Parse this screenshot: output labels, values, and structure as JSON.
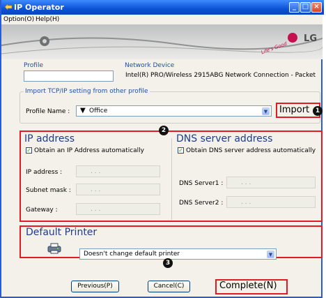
{
  "window": {
    "title": "IP Operator"
  },
  "menu": {
    "option": "Option(O)",
    "help": "Help(H)"
  },
  "brand": {
    "logo_text": "LG",
    "tagline": "Life's Good",
    "color": "#c4104f"
  },
  "profile": {
    "label": "Profile",
    "value": ""
  },
  "network_device": {
    "label": "Network Device",
    "value": "Intel(R) PRO/Wireless 2915ABG Network Connection - Packet"
  },
  "import_group": {
    "label": "Import TCP/IP setting from other profile",
    "profile_name_label": "Profile Name :",
    "profile_name_value": "Office",
    "import_button": "Import"
  },
  "ip_address": {
    "heading": "IP address",
    "auto_checkbox": "Obtain an IP Address automatically",
    "auto_checked": true,
    "fields": [
      {
        "label": "IP address :",
        "value": ". . ."
      },
      {
        "label": "Subnet mask :",
        "value": ". . ."
      },
      {
        "label": "Gateway :",
        "value": ". . ."
      }
    ]
  },
  "dns": {
    "heading": "DNS server address",
    "auto_checkbox": "Obtain DNS server address automatically",
    "auto_checked": true,
    "fields": [
      {
        "label": "DNS Server1 :",
        "value": ". . ."
      },
      {
        "label": "DNS Server2 :",
        "value": ". . ."
      }
    ]
  },
  "printer": {
    "heading": "Default Printer",
    "value": "Doesn't change default printer"
  },
  "badges": {
    "one": "1",
    "two": "2",
    "three": "3"
  },
  "buttons": {
    "previous": "Previous(P)",
    "cancel": "Cancel(C)",
    "complete": "Complete(N)"
  },
  "colors": {
    "accent_red": "#e01b24",
    "titlebar_blue": "#0b52d6"
  }
}
